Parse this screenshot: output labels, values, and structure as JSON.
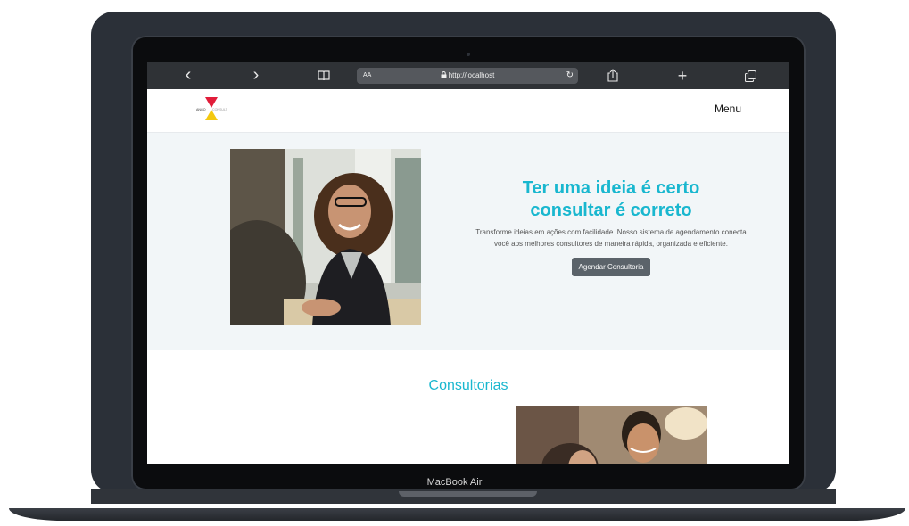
{
  "device": {
    "label": "MacBook Air"
  },
  "browser": {
    "back_icon": "‹",
    "forward_icon": "›",
    "bookmarks_icon": "book-icon",
    "text_size_label": "AA",
    "url": "http://localhost",
    "reload_icon": "↻",
    "share_icon": "share-icon",
    "new_tab_icon": "+",
    "tabs_icon": "tabs-icon"
  },
  "site": {
    "logo_text": "ANGO CONSULT",
    "menu_label": "Menu",
    "hero": {
      "title_line1": "Ter uma ideia é certo",
      "title_line2": "consultar é correto",
      "description": "Transforme ideias em ações com facilidade. Nosso sistema de agendamento conecta você aos melhores consultores de maneira rápida, organizada e eficiente.",
      "cta_label": "Agendar Consultoria"
    },
    "consultorias_title": "Consultorias"
  },
  "colors": {
    "accent": "#19b7cf",
    "button": "#5b636a",
    "hero_bg": "#f2f6f8"
  }
}
